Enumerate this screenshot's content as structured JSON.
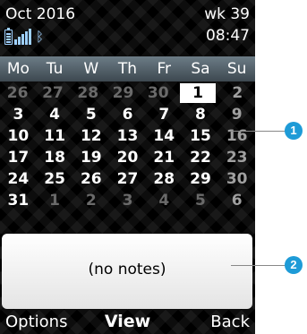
{
  "status": {
    "month_year": "Oct 2016",
    "week": "wk 39",
    "time": "08:47",
    "icons": [
      "battery-icon",
      "signal-icon",
      "bluetooth-icon"
    ]
  },
  "calendar": {
    "weekdays": [
      "Mo",
      "Tu",
      "W",
      "Th",
      "Fr",
      "Sa",
      "Su"
    ],
    "weeks": [
      [
        "26",
        "27",
        "28",
        "29",
        "30",
        "1",
        "2"
      ],
      [
        "3",
        "4",
        "5",
        "6",
        "7",
        "8",
        "9"
      ],
      [
        "10",
        "11",
        "12",
        "13",
        "14",
        "15",
        "16"
      ],
      [
        "17",
        "18",
        "19",
        "20",
        "21",
        "22",
        "23"
      ],
      [
        "24",
        "25",
        "26",
        "27",
        "28",
        "29",
        "30"
      ],
      [
        "31",
        "1",
        "2",
        "3",
        "4",
        "5",
        "6"
      ]
    ],
    "selected": "1"
  },
  "notes": {
    "text": "(no notes)"
  },
  "softkeys": {
    "left": "Options",
    "middle": "View",
    "right": "Back"
  },
  "callouts": [
    "1",
    "2"
  ],
  "colors": {
    "callout": "#1e9bd7",
    "status_icons": "#9fd0ff"
  }
}
